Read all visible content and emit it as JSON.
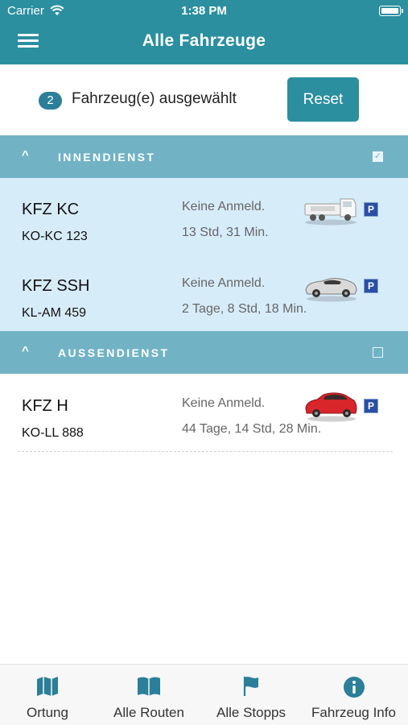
{
  "status_bar": {
    "carrier": "Carrier",
    "time": "1:38 PM"
  },
  "header": {
    "title": "Alle Fahrzeuge"
  },
  "selection": {
    "count": "2",
    "text": "Fahrzeug(e) ausgewählt",
    "reset_label": "Reset"
  },
  "groups": [
    {
      "title": "INNENDIENST",
      "checked": true,
      "vehicles": [
        {
          "name": "KFZ KC",
          "plate": "KO-KC 123",
          "status": "Keine Anmeld.",
          "duration": "13 Std, 31 Min.",
          "vehicle_icon": "truck-icon",
          "parking": "P"
        },
        {
          "name": "KFZ SSH",
          "plate": "KL-AM 459",
          "status": "Keine Anmeld.",
          "duration": "2 Tage, 8 Std, 18 Min.",
          "vehicle_icon": "convertible-car-icon",
          "parking": "P"
        }
      ]
    },
    {
      "title": "AUSSENDIENST",
      "checked": false,
      "vehicles": [
        {
          "name": "KFZ H",
          "plate": "KO-LL 888",
          "status": "Keine Anmeld.",
          "duration": "44 Tage, 14 Std, 28 Min.",
          "vehicle_icon": "red-car-icon",
          "parking": "P"
        }
      ]
    }
  ],
  "tabbar": {
    "tabs": [
      {
        "label": "Ortung",
        "icon": "map-icon"
      },
      {
        "label": "Alle Routen",
        "icon": "book-icon"
      },
      {
        "label": "Alle Stopps",
        "icon": "flag-icon"
      },
      {
        "label": "Fahrzeug Info",
        "icon": "info-icon"
      }
    ]
  },
  "colors": {
    "primary": "#2b8fa0",
    "group_header": "#71b3c5",
    "selected_row": "#d7ecf9",
    "parking": "#2a4fa2",
    "tab_icon": "#2b7f98"
  }
}
